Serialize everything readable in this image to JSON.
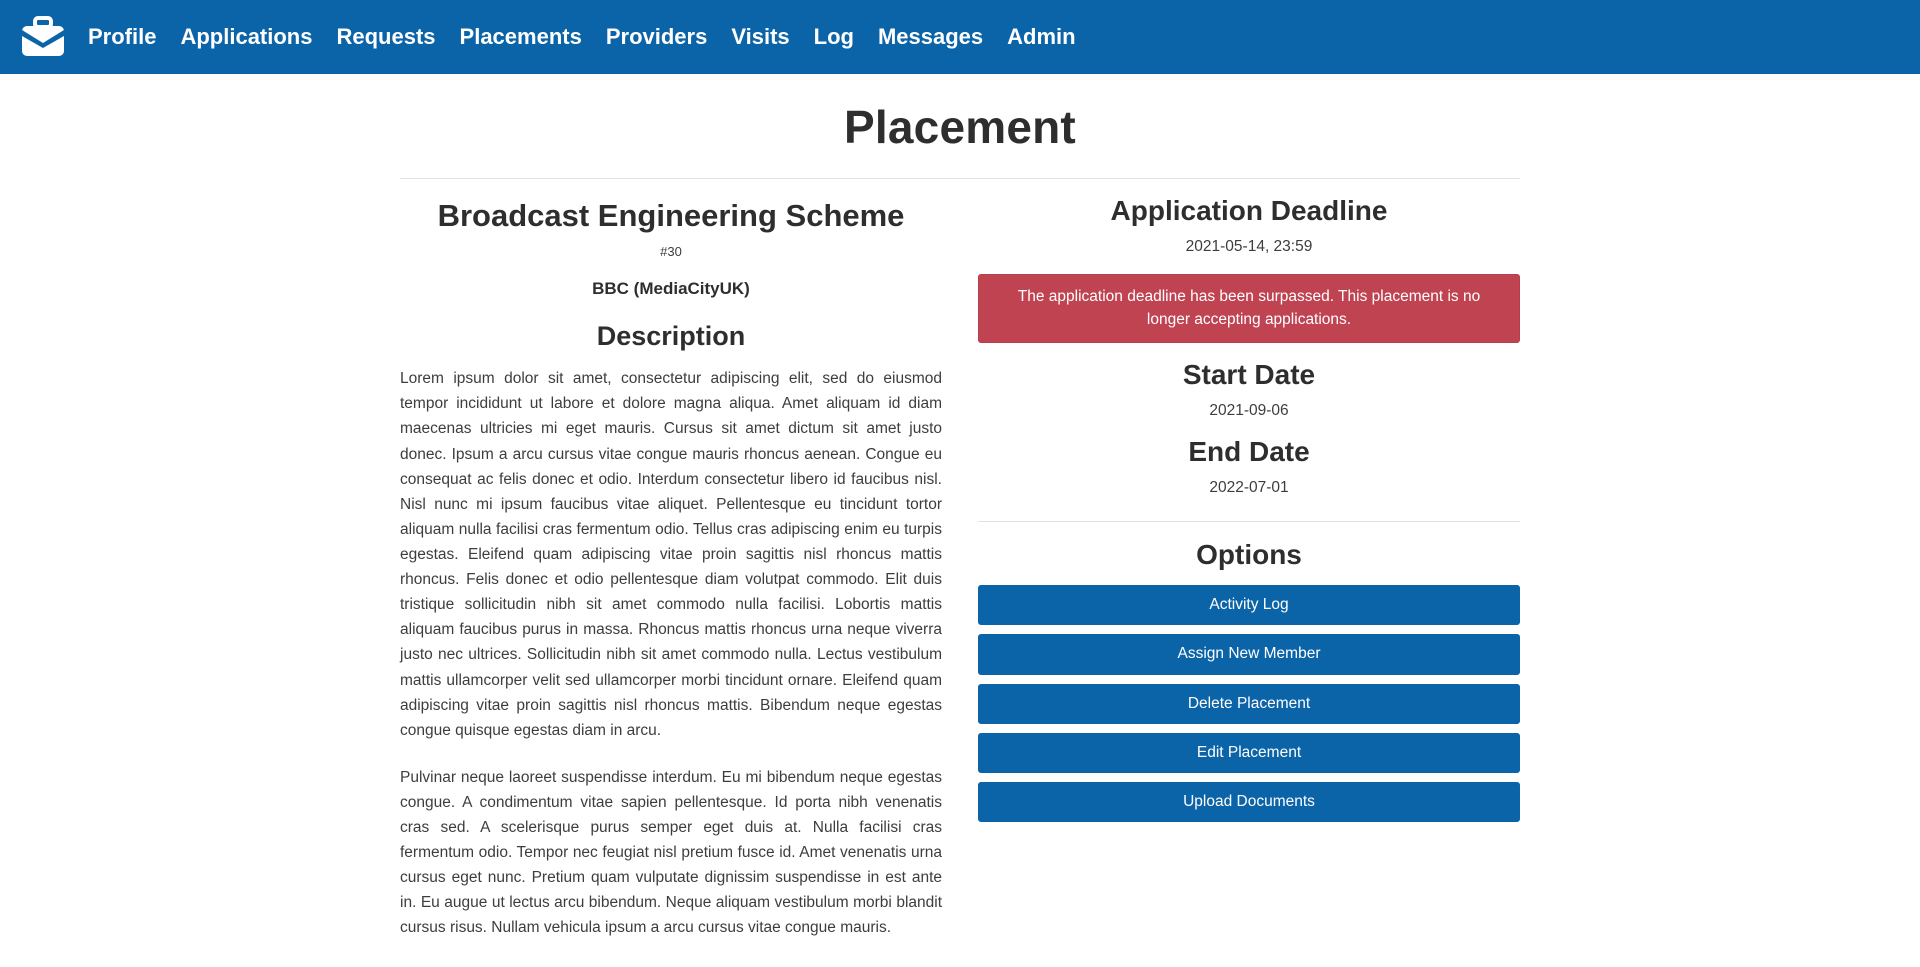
{
  "navbar": {
    "brand_icon": "briefcase-icon",
    "brand_color": "#0B63A8",
    "links": [
      {
        "label": "Profile"
      },
      {
        "label": "Applications"
      },
      {
        "label": "Requests"
      },
      {
        "label": "Placements"
      },
      {
        "label": "Providers"
      },
      {
        "label": "Visits"
      },
      {
        "label": "Log"
      },
      {
        "label": "Messages"
      },
      {
        "label": "Admin"
      }
    ]
  },
  "page": {
    "title": "Placement"
  },
  "placement": {
    "scheme_title": "Broadcast Engineering Scheme",
    "id_label": "#30",
    "provider": "BBC (MediaCityUK)",
    "description_heading": "Description",
    "description_paragraphs": [
      "Lorem ipsum dolor sit amet, consectetur adipiscing elit, sed do eiusmod tempor incididunt ut labore et dolore magna aliqua. Amet aliquam id diam maecenas ultricies mi eget mauris. Cursus sit amet dictum sit amet justo donec. Ipsum a arcu cursus vitae congue mauris rhoncus aenean. Congue eu consequat ac felis donec et odio. Interdum consectetur libero id faucibus nisl. Nisl nunc mi ipsum faucibus vitae aliquet. Pellentesque eu tincidunt tortor aliquam nulla facilisi cras fermentum odio. Tellus cras adipiscing enim eu turpis egestas. Eleifend quam adipiscing vitae proin sagittis nisl rhoncus mattis rhoncus. Felis donec et odio pellentesque diam volutpat commodo. Elit duis tristique sollicitudin nibh sit amet commodo nulla facilisi. Lobortis mattis aliquam faucibus purus in massa. Rhoncus mattis rhoncus urna neque viverra justo nec ultrices. Sollicitudin nibh sit amet commodo nulla. Lectus vestibulum mattis ullamcorper velit sed ullamcorper morbi tincidunt ornare. Eleifend quam adipiscing vitae proin sagittis nisl rhoncus mattis. Bibendum neque egestas congue quisque egestas diam in arcu.",
      "Pulvinar neque laoreet suspendisse interdum. Eu mi bibendum neque egestas congue. A condimentum vitae sapien pellentesque. Id porta nibh venenatis cras sed. A scelerisque purus semper eget duis at. Nulla facilisi cras fermentum odio. Tempor nec feugiat nisl pretium fusce id. Amet venenatis urna cursus eget nunc. Pretium quam vulputate dignissim suspendisse in est ante in. Eu augue ut lectus arcu bibendum. Neque aliquam vestibulum morbi blandit cursus risus. Nullam vehicula ipsum a arcu cursus vitae congue mauris."
    ]
  },
  "deadline": {
    "heading": "Application Deadline",
    "value": "2021-05-14, 23:59",
    "alert_text": "The application deadline has been surpassed. This placement is no longer accepting applications.",
    "alert_color": "#bf4350"
  },
  "start_date": {
    "heading": "Start Date",
    "value": "2021-09-06"
  },
  "end_date": {
    "heading": "End Date",
    "value": "2022-07-01"
  },
  "options": {
    "heading": "Options",
    "buttons": [
      {
        "label": "Activity Log"
      },
      {
        "label": "Assign New Member"
      },
      {
        "label": "Delete Placement"
      },
      {
        "label": "Edit Placement"
      },
      {
        "label": "Upload Documents"
      }
    ]
  }
}
